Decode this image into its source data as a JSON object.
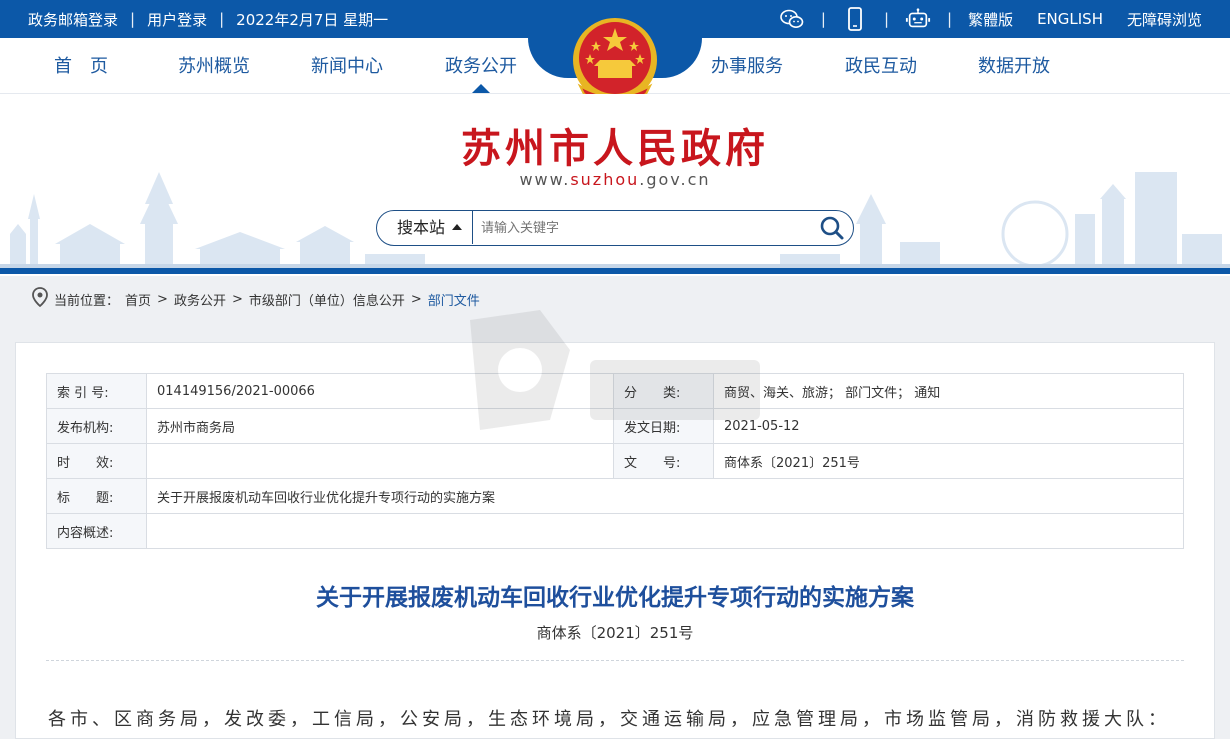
{
  "topbar": {
    "email_login": "政务邮箱登录",
    "user_login": "用户登录",
    "date": "2022年2月7日 星期一",
    "traditional": "繁體版",
    "english": "ENGLISH",
    "accessible": "无障碍浏览",
    "icons": [
      "wechat-icon",
      "mobile-icon",
      "robot-icon"
    ]
  },
  "nav": {
    "items": [
      "首　页",
      "苏州概览",
      "新闻中心",
      "政务公开",
      "办事服务",
      "政民互动",
      "数据开放"
    ],
    "active": "政务公开"
  },
  "header": {
    "title": "苏州市人民政府",
    "url_prefix": "www.",
    "url_brand": "suzhou",
    "url_suffix": ".gov.cn"
  },
  "search": {
    "scope": "搜本站",
    "placeholder": "请输入关键字"
  },
  "breadcrumb": {
    "label": "当前位置：",
    "items": [
      "首页",
      "政务公开",
      "市级部门（单位）信息公开",
      "部门文件"
    ],
    "sep": ">"
  },
  "meta": {
    "index_label": "索 引 号:",
    "index_value": "014149156/2021-00066",
    "category_label": "分　　类:",
    "category_value": "商贸、海关、旅游；  部门文件；  通知",
    "org_label": "发布机构:",
    "org_value": "苏州市商务局",
    "date_label": "发文日期:",
    "date_value": "2021-05-12",
    "valid_label": "时　　效:",
    "valid_value": "",
    "docno_label": "文　　号:",
    "docno_value": "商体系〔2021〕251号",
    "subject_label": "标　　题:",
    "subject_value": "关于开展报废机动车回收行业优化提升专项行动的实施方案",
    "summary_label": "内容概述:",
    "summary_value": ""
  },
  "document": {
    "title": "关于开展报废机动车回收行业优化提升专项行动的实施方案",
    "number": "商体系〔2021〕251号",
    "first_paragraph": "各市、区商务局，发改委，工信局，公安局，生态环境局，交通运输局，应急管理局，市场监管局，消防救援大队："
  },
  "colors": {
    "primary": "#0c58a8",
    "title_red": "#c8161d",
    "doc_title": "#1e4f9c"
  }
}
